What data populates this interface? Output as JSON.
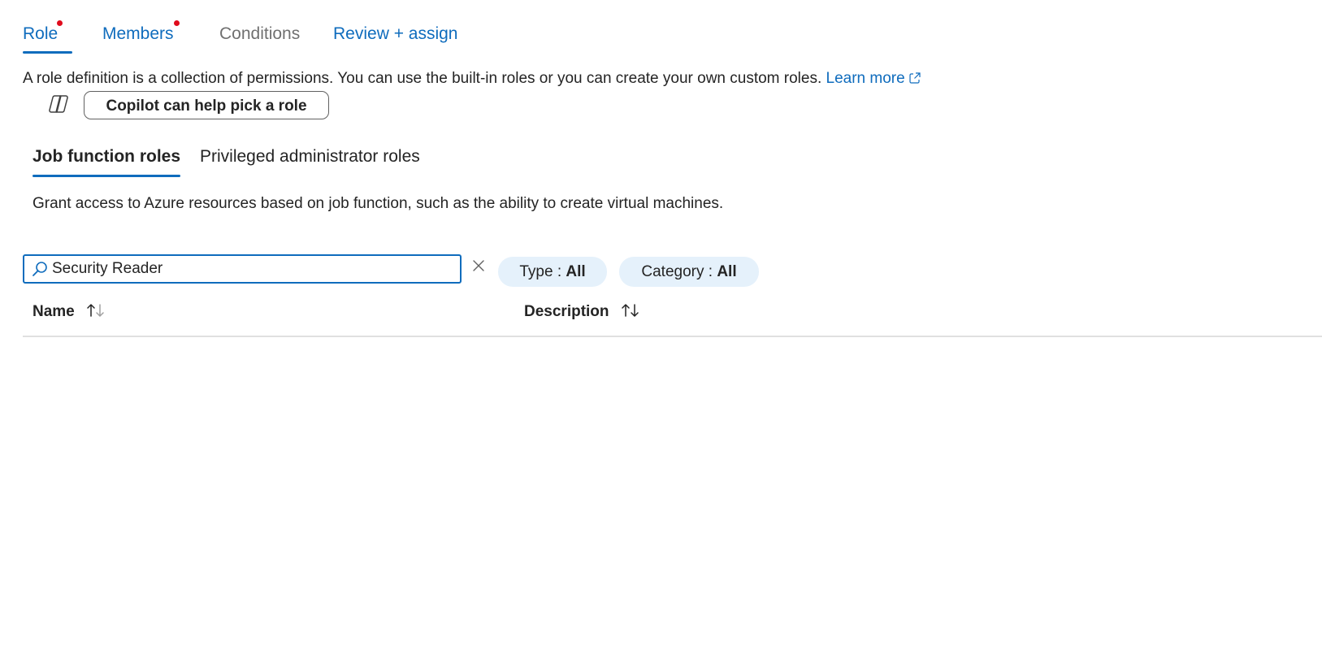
{
  "wizard_tabs": [
    {
      "label": "Role",
      "state": "active",
      "required": true
    },
    {
      "label": "Members",
      "state": "link",
      "required": true
    },
    {
      "label": "Conditions",
      "state": "disabled",
      "required": false
    },
    {
      "label": "Review + assign",
      "state": "link",
      "required": false
    }
  ],
  "intro": {
    "text": "A role definition is a collection of permissions. You can use the built-in roles or you can create your own custom roles.",
    "learn_more": "Learn more"
  },
  "copilot": {
    "icon": "copilot-icon",
    "button_label": "Copilot can help pick a role"
  },
  "role_tabs": [
    {
      "label": "Job function roles",
      "active": true
    },
    {
      "label": "Privileged administrator roles",
      "active": false
    }
  ],
  "description": "Grant access to Azure resources based on job function, such as the ability to create virtual machines.",
  "search": {
    "value": "Security Reader",
    "placeholder": "",
    "icon": "search-icon",
    "clear_icon": "close-icon"
  },
  "filters": {
    "type": {
      "label": "Type : ",
      "value": "All"
    },
    "category": {
      "label": "Category : ",
      "value": "All"
    }
  },
  "table": {
    "columns": [
      {
        "label": "Name",
        "sort_icon": "sort-arrows-icon"
      },
      {
        "label": "Description",
        "sort_icon": "sort-arrows-icon"
      }
    ],
    "rows": []
  },
  "colors": {
    "accent": "#0f6cbd",
    "required_dot": "#e00b1c",
    "pill_bg": "#e5f1fb"
  }
}
